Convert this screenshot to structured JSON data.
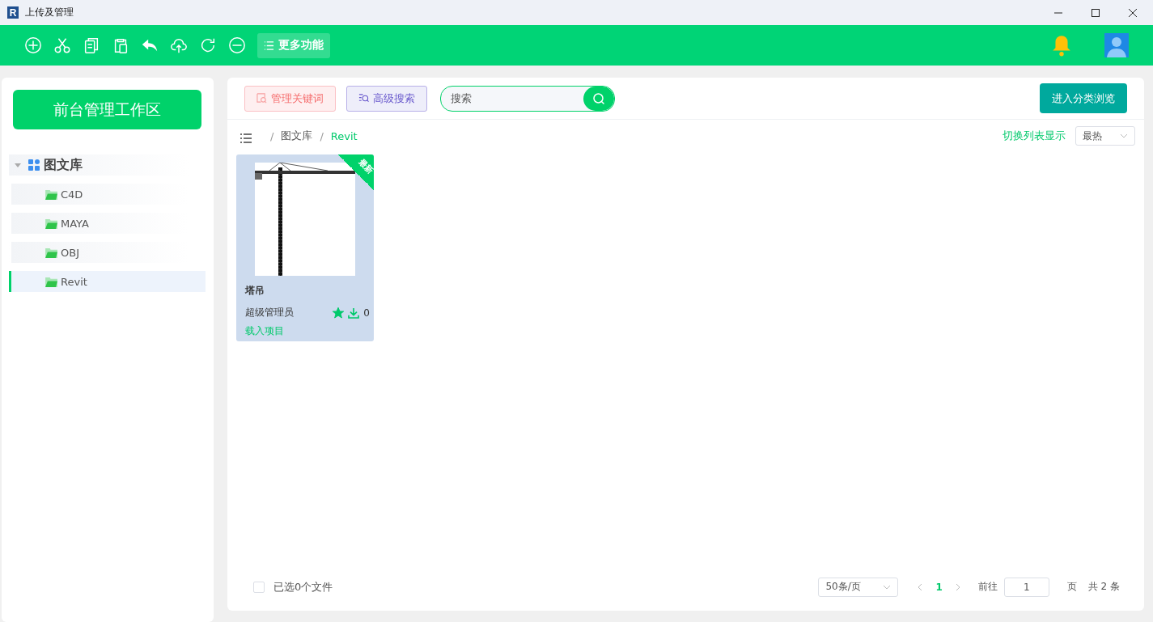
{
  "window": {
    "app_icon_letter": "R",
    "title": "上传及管理"
  },
  "toolbar": {
    "more_button": "更多功能"
  },
  "sidebar": {
    "workspace_button": "前台管理工作区",
    "tree": {
      "label": "图文库",
      "expanded": true,
      "children": [
        {
          "label": "C4D",
          "selected": false
        },
        {
          "label": "MAYA",
          "selected": false
        },
        {
          "label": "OBJ",
          "selected": false
        },
        {
          "label": "Revit",
          "selected": true
        }
      ]
    }
  },
  "main": {
    "keyword_button": "管理关键词",
    "advanced_search_button": "高级搜索",
    "search": {
      "placeholder": "搜索"
    },
    "browse_button": "进入分类浏览",
    "breadcrumb_separator": "/",
    "breadcrumb": [
      "图文库",
      "Revit"
    ],
    "view_toggle": "切换列表显示",
    "sort_select": "最热",
    "cards": [
      {
        "title": "塔吊",
        "author": "超级管理员",
        "badge": "最新",
        "favorited": true,
        "downloads": "0",
        "action": "载入项目"
      }
    ],
    "footer": {
      "select_all": {
        "checked": false,
        "label": "已选0个文件"
      },
      "page_size": "50条/页",
      "pages": [
        {
          "label": "1",
          "selected": true
        }
      ],
      "goto_label": "前往",
      "page_input": "1",
      "page_unit": "页",
      "total": "共 2 条"
    }
  }
}
